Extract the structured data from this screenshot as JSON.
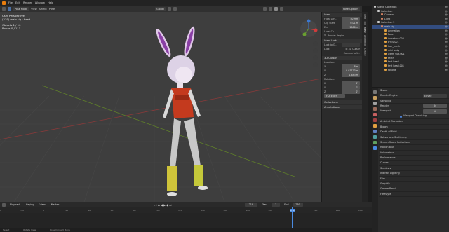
{
  "topbar": {
    "menus": [
      "File",
      "Edit",
      "Render",
      "Window",
      "Help"
    ],
    "mode": "Pose Mode",
    "vmenus": [
      "View",
      "Select",
      "Pose"
    ],
    "orientation": "Global",
    "pose_options": "Pose Options"
  },
  "viewport": {
    "info": [
      "User Perspective",
      "(219) main rig : head",
      "Objects   1 / 10",
      "Bones     0 / 111"
    ]
  },
  "npanel": {
    "tabs": [
      "Item",
      "Tool",
      "View",
      "Animation",
      "Create"
    ],
    "view_title": "View",
    "focal_label": "Focal Len...",
    "focal": "50 mm",
    "clip_start_label": "Clip Start",
    "clip_start": "0.01 m",
    "clip_end_label": "End",
    "clip_end": "1000 m",
    "local_camera": "Local Ca...",
    "render_region": "Render Region",
    "view_lock": "View Lock",
    "lock_to_object": "Lock to O...",
    "lock": "Lock",
    "to_3d_cursor": "To 3D Cursor",
    "camera_to_view": "Camera to V...",
    "cursor_title": "3D Cursor",
    "location": "Location:",
    "x": "X",
    "x_val": "-8 m",
    "y": "Y",
    "y_val": "0.07773 m",
    "z": "Z",
    "z_val": "1.483 m",
    "rotation": "Rotation:",
    "rx": "0°",
    "ry": "0°",
    "rz": "0°",
    "euler": "XYZ Euler",
    "collections": "Collections",
    "annotations": "Annotations"
  },
  "outliner": {
    "items": [
      {
        "label": "Scene Collection",
        "indent": 0
      },
      {
        "label": "Collection",
        "indent": 1
      },
      {
        "label": "Camera",
        "indent": 2
      },
      {
        "label": "Light",
        "indent": 2
      },
      {
        "label": "Collection 2",
        "indent": 1
      },
      {
        "label": "main rig",
        "indent": 2,
        "selected": true
      },
      {
        "label": "Animation",
        "indent": 3
      },
      {
        "label": "Pose",
        "indent": 3
      },
      {
        "label": "Armature.003",
        "indent": 3
      },
      {
        "label": "EYES.001",
        "indent": 3
      },
      {
        "label": "hair_mesh",
        "indent": 3
      },
      {
        "label": "mini body",
        "indent": 3
      },
      {
        "label": "warm suit.001",
        "indent": 3
      },
      {
        "label": "teeth",
        "indent": 3
      },
      {
        "label": "test head",
        "indent": 3
      },
      {
        "label": "test head.001",
        "indent": 3
      },
      {
        "label": "tongue",
        "indent": 3
      }
    ]
  },
  "properties": {
    "scene": "Scene",
    "render_engine_label": "Render Engine",
    "render_engine": "Eevee",
    "sampling": "Sampling",
    "render_label": "Render",
    "render_val": "64",
    "viewport_label": "Viewport",
    "viewport_val": "16",
    "denoise": "Viewport Denoising",
    "sections": [
      "Ambient Occlusion",
      "Bloom",
      "Depth of Field",
      "Subsurface Scattering",
      "Screen Space Reflections",
      "Motion Blur",
      "Volumetrics",
      "Performance",
      "Curves",
      "Shadows",
      "Indirect Lighting",
      "Film",
      "Simplify",
      "Grease Pencil",
      "Freestyle"
    ]
  },
  "timeline": {
    "playback": "Playback",
    "keying": "Keying",
    "view": "View",
    "marker": "Marker",
    "frame": "219",
    "start_label": "Start",
    "start": "1",
    "end_label": "End",
    "end": "250",
    "ruler": [
      "-40",
      "-20",
      "0",
      "20",
      "40",
      "60",
      "80",
      "100",
      "120",
      "140",
      "160",
      "180",
      "200",
      "219",
      "240",
      "260",
      "280"
    ],
    "current_frame": 219,
    "frame_min": -40,
    "frame_max": 290
  },
  "status": [
    "Select",
    "Rotate View",
    "Pose Context Menu"
  ]
}
